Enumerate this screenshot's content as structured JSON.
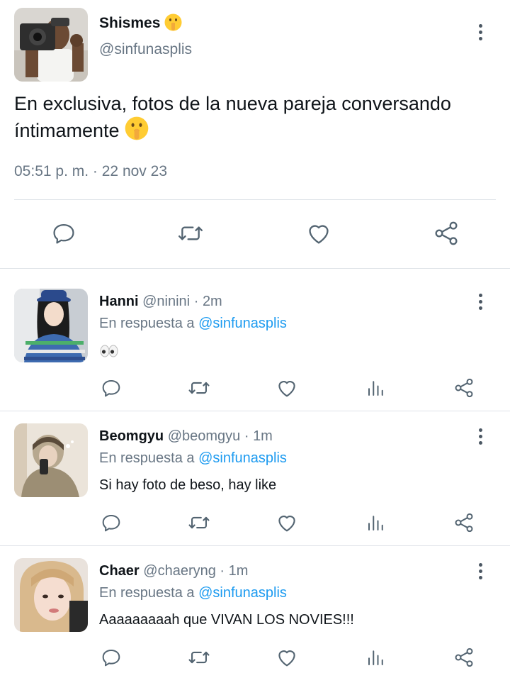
{
  "main_tweet": {
    "display_name": "Shismes",
    "name_emoji": "shushing-face-emoji",
    "handle": "@sinfunasplis",
    "text": "En exclusiva, fotos de la nueva pareja conversando íntimamente",
    "text_emoji": "shushing-face-emoji",
    "time": "05:51 p. m.",
    "separator": "·",
    "date": "22 nov 23"
  },
  "replies": [
    {
      "display_name": "Hanni",
      "handle": "@ninini",
      "separator": "·",
      "age": "2m",
      "reply_prefix": "En respuesta a",
      "reply_to": "@sinfunasplis",
      "text": "",
      "text_emoji": "eyes-emoji"
    },
    {
      "display_name": "Beomgyu",
      "handle": "@beomgyu",
      "separator": "·",
      "age": "1m",
      "reply_prefix": "En respuesta a",
      "reply_to": "@sinfunasplis",
      "text": "Si hay foto de beso, hay like"
    },
    {
      "display_name": "Chaer",
      "handle": "@chaeryng",
      "separator": "·",
      "age": "1m",
      "reply_prefix": "En respuesta a",
      "reply_to": "@sinfunasplis",
      "text": "Aaaaaaaaah que VIVAN LOS NOVIES!!!"
    }
  ],
  "icons": {
    "more": "more-vertical-icon",
    "reply": "reply-icon",
    "retweet": "retweet-icon",
    "like": "heart-icon",
    "views": "views-icon",
    "share": "share-icon"
  },
  "colors": {
    "text": "#0f1419",
    "muted": "#687684",
    "link": "#1d9bf0",
    "icon": "#536471",
    "divider": "#dfe3e8"
  }
}
